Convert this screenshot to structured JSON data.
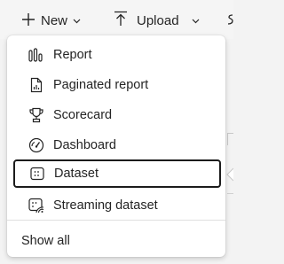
{
  "toolbar": {
    "new_label": "New",
    "new_icon": "plus-icon",
    "upload_label": "Upload",
    "upload_icon": "upload-icon",
    "chevron_icon": "chevron-down-icon"
  },
  "menu": {
    "items": [
      {
        "label": "Report",
        "icon": "report-icon",
        "selected": false
      },
      {
        "label": "Paginated report",
        "icon": "paginated-report-icon",
        "selected": false
      },
      {
        "label": "Scorecard",
        "icon": "trophy-icon",
        "selected": false
      },
      {
        "label": "Dashboard",
        "icon": "gauge-icon",
        "selected": false
      },
      {
        "label": "Dataset",
        "icon": "dataset-icon",
        "selected": true
      },
      {
        "label": "Streaming dataset",
        "icon": "streaming-dataset-icon",
        "selected": false
      }
    ],
    "show_all_label": "Show all"
  },
  "colors": {
    "text": "#242424",
    "menu_bg": "#ffffff",
    "page_bg": "#f3f3f3",
    "focus_border": "#1b1b1b"
  }
}
